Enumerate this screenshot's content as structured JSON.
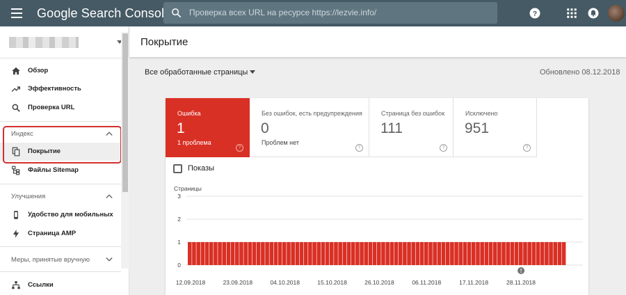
{
  "header": {
    "app_title": "Google Search Console",
    "search_placeholder": "Проверка всех URL на ресурсе https://lezvie.info/"
  },
  "sidebar": {
    "items": [
      {
        "label": "Обзор",
        "icon": "home-icon"
      },
      {
        "label": "Эффективность",
        "icon": "trending-up-icon"
      },
      {
        "label": "Проверка URL",
        "icon": "search-icon"
      }
    ],
    "section_index": {
      "label": "Индекс"
    },
    "index_items": [
      {
        "label": "Покрытие",
        "icon": "copy-icon",
        "active": true
      },
      {
        "label": "Файлы Sitemap",
        "icon": "sitemap-icon"
      }
    ],
    "section_improvements": {
      "label": "Улучшения"
    },
    "improvement_items": [
      {
        "label": "Удобство для мобильных",
        "icon": "phone-icon"
      },
      {
        "label": "Страница AMP",
        "icon": "bolt-icon"
      }
    ],
    "section_manual": {
      "label": "Меры, принятые вручную"
    },
    "links_item": {
      "label": "Ссылки",
      "icon": "links-icon"
    }
  },
  "main": {
    "title": "Покрытие",
    "filter_label": "Все обработанные страницы",
    "updated": "Обновлено 08.12.2018",
    "tiles": [
      {
        "label": "Ошибка",
        "value": "1",
        "sub": "1 проблема",
        "accent": "#d93025"
      },
      {
        "label": "Без ошибок, есть предупреждения",
        "value": "0",
        "sub": "Проблем нет"
      },
      {
        "label": "Страница без ошибок",
        "value": "111",
        "sub": ""
      },
      {
        "label": "Исключено",
        "value": "951",
        "sub": ""
      }
    ],
    "impressions_label": "Показы"
  },
  "chart_data": {
    "type": "bar",
    "ylabel": "Страницы",
    "ylim": [
      0,
      3
    ],
    "yticks": [
      "0",
      "1",
      "2",
      "3"
    ],
    "x_tick_labels": [
      "12.09.2018",
      "23.09.2018",
      "04.10.2018",
      "15.10.2018",
      "26.10.2018",
      "06.11.2018",
      "17.11.2018",
      "28.11.2018"
    ],
    "series": [
      {
        "color": "#d93025",
        "values": [
          1,
          1,
          1,
          1,
          1,
          1,
          1,
          1,
          1,
          1,
          1,
          1,
          1,
          1,
          1,
          1,
          1,
          1,
          1,
          1,
          1,
          1,
          1,
          1,
          1,
          1,
          1,
          1,
          1,
          1,
          1,
          1,
          1,
          1,
          1,
          1,
          1,
          1,
          1,
          1,
          1,
          1,
          1,
          1,
          1,
          1,
          1,
          1,
          1,
          1,
          1,
          1,
          1,
          1,
          1,
          1,
          1,
          1,
          1,
          1,
          1,
          1,
          1,
          1,
          1,
          1,
          1,
          1,
          1,
          1,
          1,
          1,
          1,
          1,
          1,
          1,
          1,
          1,
          1,
          1,
          1,
          1,
          1,
          1,
          1,
          1,
          1,
          1
        ]
      }
    ],
    "annotation": {
      "label": "!",
      "x_index": 77
    },
    "grid": true
  },
  "colors": {
    "topbar": "#455a64",
    "error": "#d93025",
    "highlight": "#d32f2f"
  }
}
